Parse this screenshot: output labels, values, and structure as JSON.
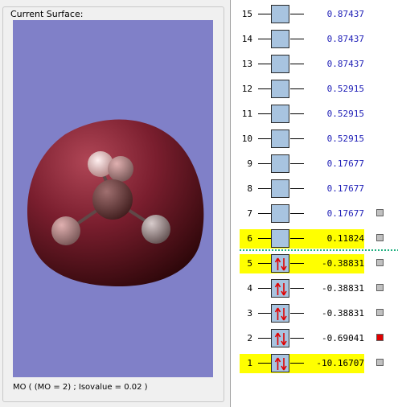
{
  "surface_panel": {
    "title": "Current Surface:",
    "caption": "MO ( (MO = 2) ; Isovalue = 0.02 )"
  },
  "colors": {
    "viewport_background": "#8080c8",
    "orbital_lobe": "#7a1e2e",
    "highlight": "#ffff00",
    "virtual_energy_text": "#2020b8",
    "occupied_energy_text": "#000000",
    "orbital_box": "#a8c4e0",
    "marker_default": "#c0c0c0",
    "marker_selected": "#e00000",
    "homo_lumo_separator": "#20b080"
  },
  "orbitals": [
    {
      "number": "15",
      "energy": "0.87437",
      "occupied": false,
      "highlighted": false,
      "marker": "none"
    },
    {
      "number": "14",
      "energy": "0.87437",
      "occupied": false,
      "highlighted": false,
      "marker": "none"
    },
    {
      "number": "13",
      "energy": "0.87437",
      "occupied": false,
      "highlighted": false,
      "marker": "none"
    },
    {
      "number": "12",
      "energy": "0.52915",
      "occupied": false,
      "highlighted": false,
      "marker": "none"
    },
    {
      "number": "11",
      "energy": "0.52915",
      "occupied": false,
      "highlighted": false,
      "marker": "none"
    },
    {
      "number": "10",
      "energy": "0.52915",
      "occupied": false,
      "highlighted": false,
      "marker": "none"
    },
    {
      "number": "9",
      "energy": "0.17677",
      "occupied": false,
      "highlighted": false,
      "marker": "none"
    },
    {
      "number": "8",
      "energy": "0.17677",
      "occupied": false,
      "highlighted": false,
      "marker": "none"
    },
    {
      "number": "7",
      "energy": "0.17677",
      "occupied": false,
      "highlighted": false,
      "marker": "gray"
    },
    {
      "number": "6",
      "energy": "0.11824",
      "occupied": false,
      "highlighted": true,
      "marker": "gray"
    },
    {
      "number": "5",
      "energy": "-0.38831",
      "occupied": true,
      "highlighted": true,
      "marker": "gray"
    },
    {
      "number": "4",
      "energy": "-0.38831",
      "occupied": true,
      "highlighted": false,
      "marker": "gray"
    },
    {
      "number": "3",
      "energy": "-0.38831",
      "occupied": true,
      "highlighted": false,
      "marker": "gray"
    },
    {
      "number": "2",
      "energy": "-0.69041",
      "occupied": true,
      "highlighted": false,
      "marker": "red"
    },
    {
      "number": "1",
      "energy": "-10.16707",
      "occupied": true,
      "highlighted": true,
      "marker": "gray"
    }
  ]
}
